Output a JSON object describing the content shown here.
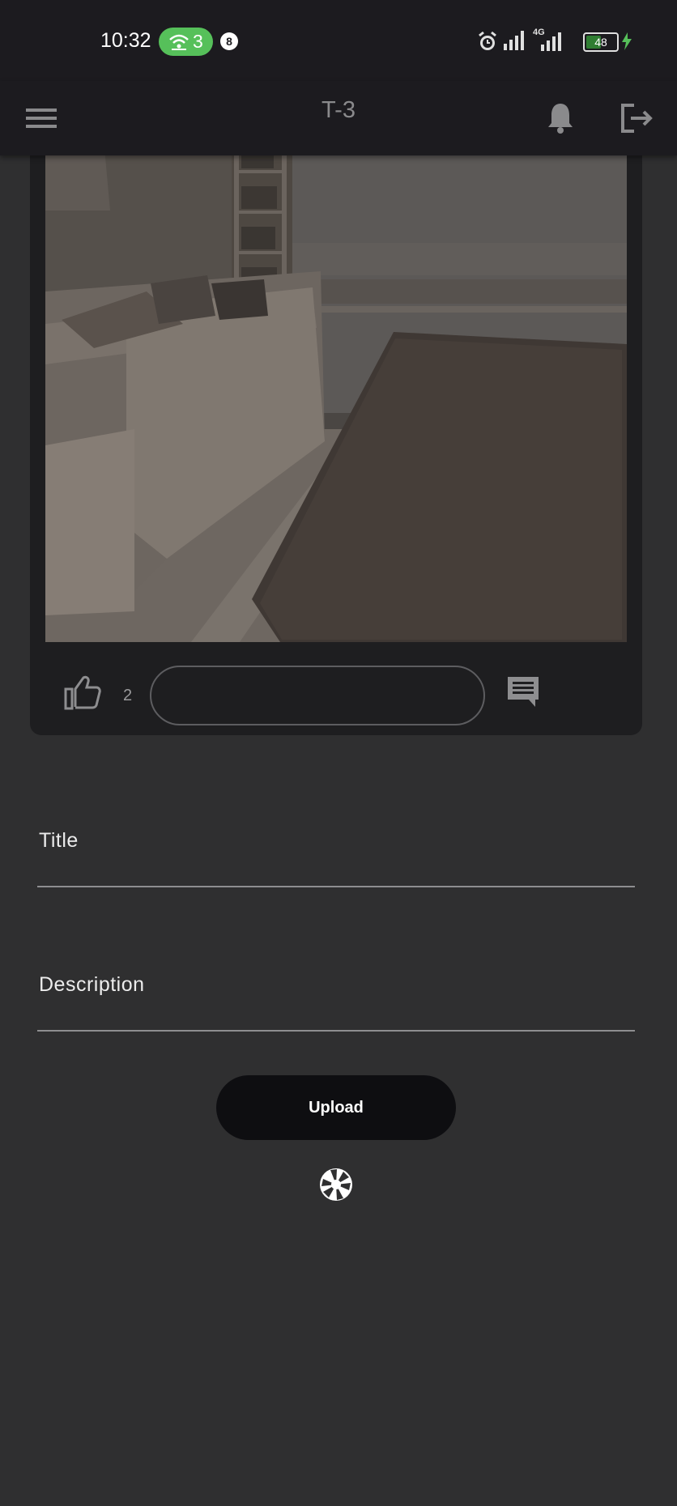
{
  "status_bar": {
    "time": "10:32",
    "hotspot_count": "3",
    "notification_count": "8",
    "network_type": "4G",
    "battery_level": "48"
  },
  "app_bar": {
    "title": "T-3",
    "icons": [
      "menu-icon",
      "bell-icon",
      "logout-icon"
    ]
  },
  "post_card": {
    "image": "living-room-photo",
    "like_count": "2",
    "comment_placeholder": "",
    "icons": [
      "thumbs-up-icon",
      "comment-icon"
    ]
  },
  "form": {
    "title_label": "Title",
    "description_label": "Description",
    "upload_label": "Upload",
    "camera_icon": "camera-aperture-icon"
  },
  "colors": {
    "background": "#2f2f30",
    "bar": "#1c1b1f",
    "card": "#1e1e20",
    "hotspot": "#56c05a",
    "button": "#0e0e11"
  }
}
